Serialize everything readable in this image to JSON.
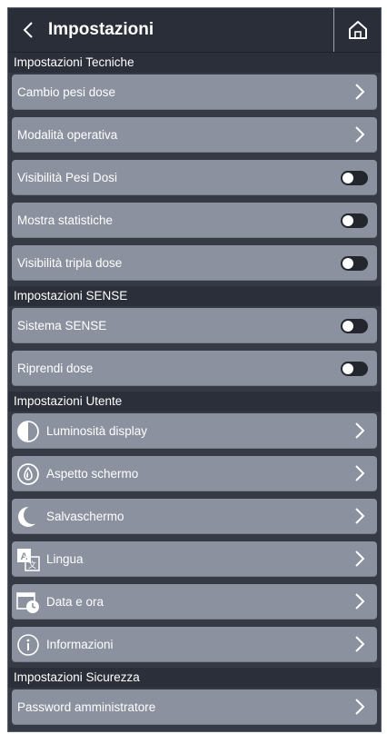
{
  "header": {
    "title": "Impostazioni",
    "back_icon": "chevron-left-icon",
    "home_icon": "home-icon"
  },
  "sections": {
    "tecniche": {
      "title": "Impostazioni Tecniche",
      "items": [
        {
          "label": "Cambio pesi dose",
          "control": "chevron"
        },
        {
          "label": "Modalità operativa",
          "control": "chevron"
        },
        {
          "label": "Visibilità Pesi Dosi",
          "control": "toggle",
          "state": "off"
        },
        {
          "label": "Mostra statistiche",
          "control": "toggle",
          "state": "off"
        },
        {
          "label": "Visibilità tripla dose",
          "control": "toggle",
          "state": "off"
        }
      ]
    },
    "sense": {
      "title": "Impostazioni SENSE",
      "items": [
        {
          "label": "Sistema SENSE",
          "control": "toggle",
          "state": "off"
        },
        {
          "label": "Riprendi dose",
          "control": "toggle",
          "state": "off"
        }
      ]
    },
    "utente": {
      "title": "Impostazioni Utente",
      "items": [
        {
          "label": "Luminosità display",
          "icon": "brightness-icon",
          "control": "chevron"
        },
        {
          "label": "Aspetto schermo",
          "icon": "drop-icon",
          "control": "chevron"
        },
        {
          "label": "Salvaschermo",
          "icon": "moon-icon",
          "control": "chevron"
        },
        {
          "label": "Lingua",
          "icon": "language-icon",
          "control": "chevron"
        },
        {
          "label": "Data e ora",
          "icon": "calendar-clock-icon",
          "control": "chevron"
        },
        {
          "label": "Informazioni",
          "icon": "info-icon",
          "control": "chevron"
        }
      ]
    },
    "sicurezza": {
      "title": "Impostazioni Sicurezza",
      "items": [
        {
          "label": "Password amministratore",
          "control": "chevron"
        }
      ]
    }
  },
  "colors": {
    "background": "#353a45",
    "header": "#2a2e38",
    "item": "#8c919f",
    "toggle_off": "#23262d"
  }
}
